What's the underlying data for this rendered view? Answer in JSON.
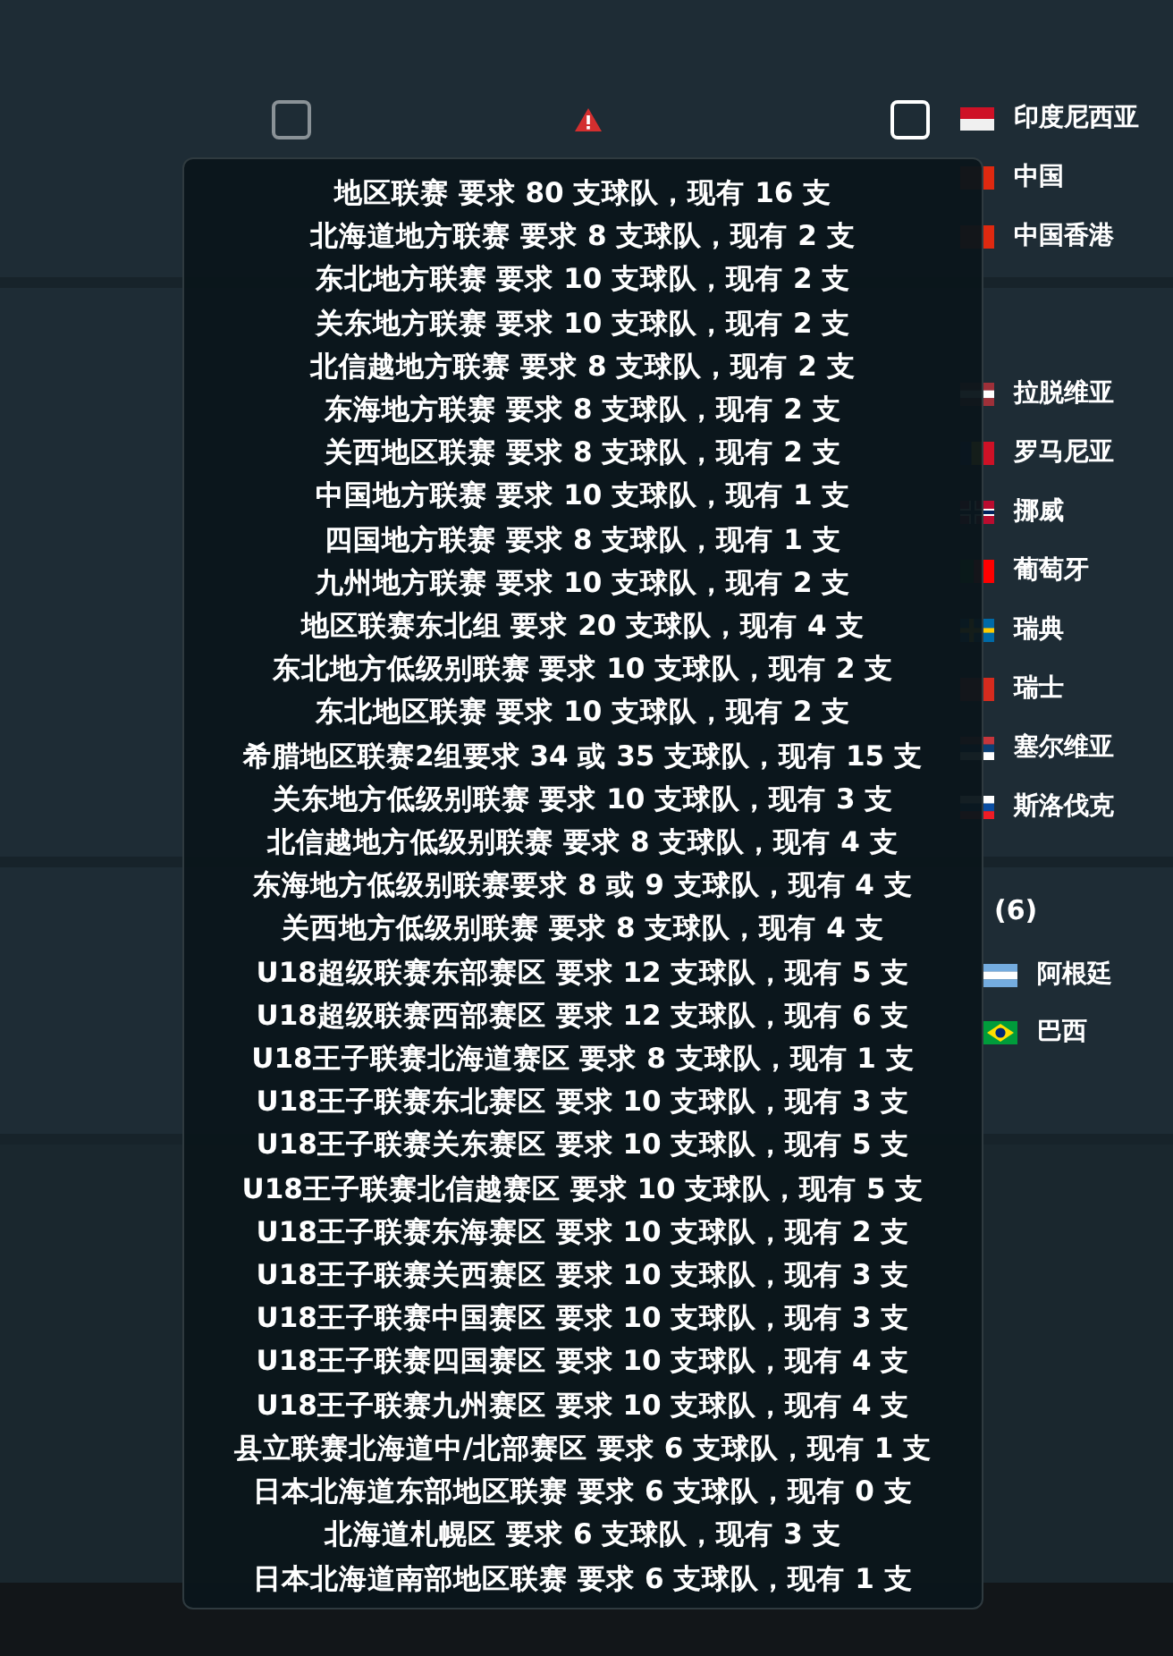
{
  "top_row": {
    "left_checkbox": {
      "checked": false,
      "disabled": true
    },
    "right_checkbox": {
      "checked": false,
      "disabled": false
    }
  },
  "group_1_countries": [
    {
      "name": "印度尼西亚",
      "kind": "id"
    },
    {
      "name": "中国",
      "kind": "cn"
    },
    {
      "name": "中国香港",
      "kind": "hk"
    }
  ],
  "group_2_countries": [
    {
      "name": "拉脱维亚",
      "kind": "lv"
    },
    {
      "name": "罗马尼亚",
      "kind": "ro"
    },
    {
      "name": "挪威",
      "kind": "no"
    },
    {
      "name": "葡萄牙",
      "kind": "pt"
    },
    {
      "name": "瑞典",
      "kind": "se"
    },
    {
      "name": "瑞士",
      "kind": "ch"
    },
    {
      "name": "塞尔维亚",
      "kind": "rs"
    },
    {
      "name": "斯洛伐克",
      "kind": "sk"
    }
  ],
  "group_3": {
    "count": "(6)",
    "countries": [
      {
        "name": "阿根廷",
        "kind": "ar"
      },
      {
        "name": "巴西",
        "kind": "br"
      }
    ]
  },
  "tooltip_lines": [
    "地区联赛 要求 80 支球队，现有 16 支",
    "北海道地方联赛 要求 8 支球队，现有 2 支",
    "东北地方联赛 要求 10 支球队，现有 2 支",
    "关东地方联赛 要求 10 支球队，现有 2 支",
    "北信越地方联赛 要求 8 支球队，现有 2 支",
    "东海地方联赛 要求 8 支球队，现有 2 支",
    "关西地区联赛 要求 8 支球队，现有 2 支",
    "中国地方联赛 要求 10 支球队，现有 1 支",
    "四国地方联赛 要求 8 支球队，现有 1 支",
    "九州地方联赛 要求 10 支球队，现有 2 支",
    "地区联赛东北组 要求 20 支球队，现有 4 支",
    "东北地方低级别联赛 要求 10 支球队，现有 2 支",
    "东北地区联赛 要求 10 支球队，现有 2 支",
    "希腊地区联赛2组要求 34 或 35 支球队，现有 15 支",
    "关东地方低级别联赛 要求 10 支球队，现有 3 支",
    "北信越地方低级别联赛 要求 8 支球队，现有 4 支",
    "东海地方低级别联赛要求 8 或 9 支球队，现有 4 支",
    "关西地方低级别联赛 要求 8 支球队，现有 4 支",
    "U18超级联赛东部赛区 要求 12 支球队，现有 5 支",
    "U18超级联赛西部赛区 要求 12 支球队，现有 6 支",
    "U18王子联赛北海道赛区 要求 8 支球队，现有 1 支",
    "U18王子联赛东北赛区 要求 10 支球队，现有 3 支",
    "U18王子联赛关东赛区 要求 10 支球队，现有 5 支",
    "U18王子联赛北信越赛区 要求 10 支球队，现有 5 支",
    "U18王子联赛东海赛区 要求 10 支球队，现有 2 支",
    "U18王子联赛关西赛区 要求 10 支球队，现有 3 支",
    "U18王子联赛中国赛区 要求 10 支球队，现有 3 支",
    "U18王子联赛四国赛区 要求 10 支球队，现有 4 支",
    "U18王子联赛九州赛区 要求 10 支球队，现有 4 支",
    "县立联赛北海道中/北部赛区 要求 6 支球队，现有 1 支",
    "日本北海道东部地区联赛 要求 6 支球队，现有 0 支",
    "北海道札幌区 要求 6 支球队，现有 3 支",
    "日本北海道南部地区联赛 要求 6 支球队，现有 1 支"
  ]
}
